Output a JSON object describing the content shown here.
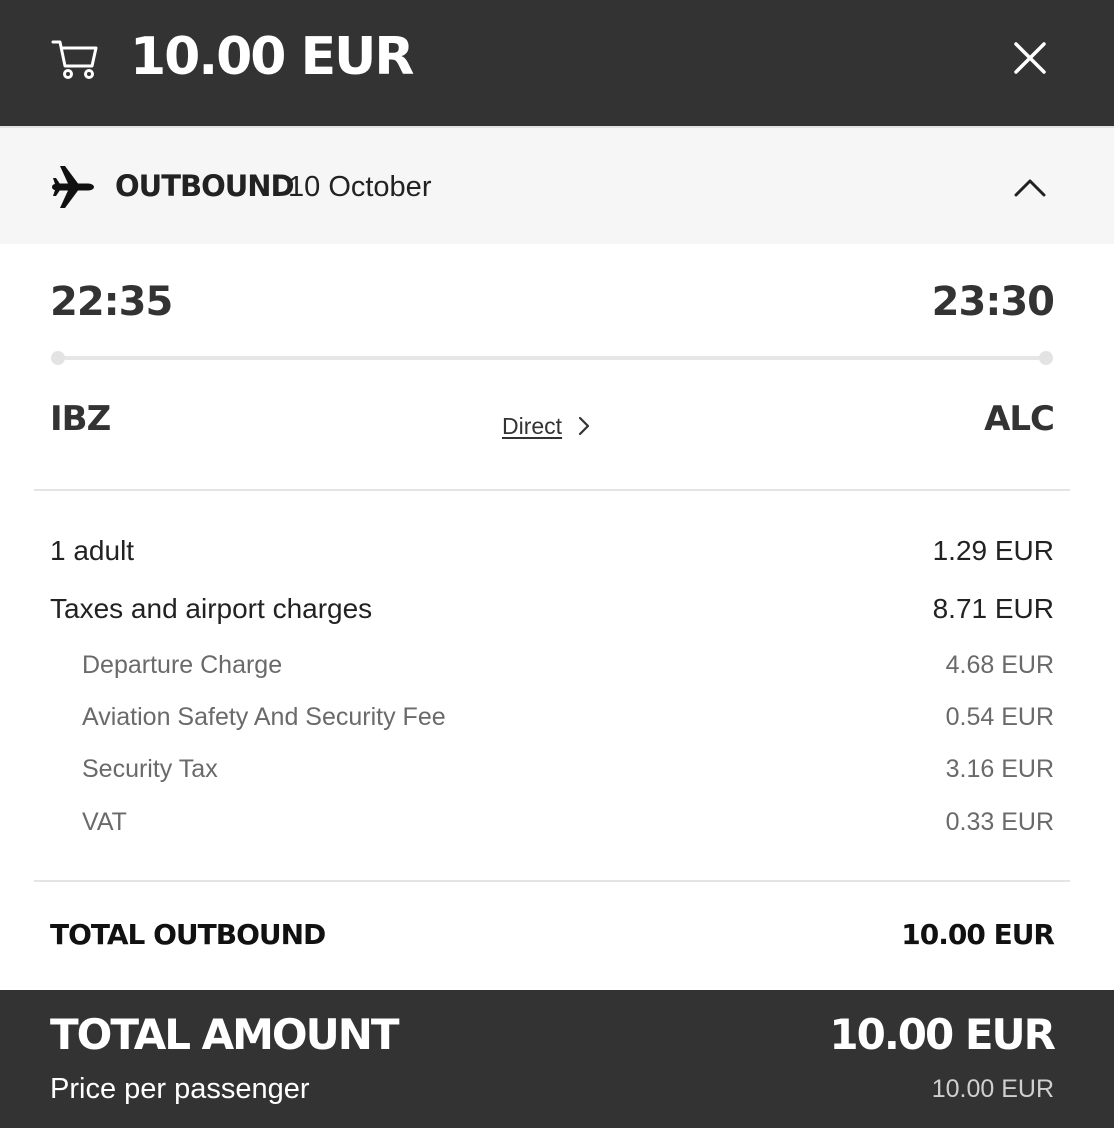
{
  "header": {
    "total": "10.00 EUR",
    "cart_icon": "cart-icon",
    "close_icon": "close-icon"
  },
  "outbound": {
    "label": "OUTBOUND",
    "date": "10 October",
    "expanded": true,
    "departure_time": "22:35",
    "arrival_time": "23:30",
    "origin": "IBZ",
    "destination": "ALC",
    "stops_label": "Direct"
  },
  "breakdown": {
    "rows": [
      {
        "label": "1 adult",
        "value": "1.29 EUR"
      },
      {
        "label": "Taxes and airport charges",
        "value": "8.71 EUR"
      }
    ],
    "tax_items": [
      {
        "label": "Departure Charge",
        "value": "4.68 EUR"
      },
      {
        "label": "Aviation Safety And Security Fee",
        "value": "0.54 EUR"
      },
      {
        "label": "Security Tax",
        "value": "3.16 EUR"
      },
      {
        "label": "VAT",
        "value": "0.33 EUR"
      }
    ],
    "total_label": "TOTAL OUTBOUND",
    "total_value": "10.00 EUR"
  },
  "footer": {
    "title": "TOTAL AMOUNT",
    "amount": "10.00 EUR",
    "per_passenger_label": "Price per passenger",
    "per_passenger_value": "10.00 EUR"
  },
  "colors": {
    "header_bg": "#333333",
    "section_bg": "#f6f6f6",
    "text": "#222222",
    "muted_text": "#6a6a6a"
  }
}
